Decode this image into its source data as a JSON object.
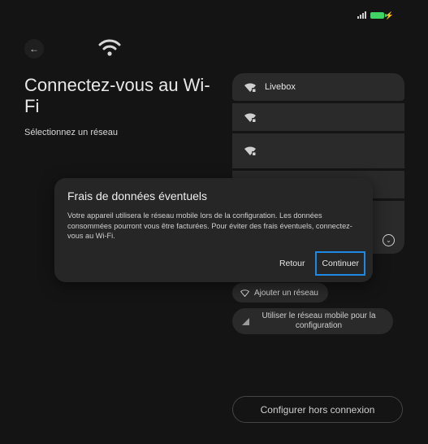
{
  "header": {
    "title": "Connectez-vous au Wi-Fi",
    "subtitle": "Sélectionnez un réseau"
  },
  "networks": [
    {
      "ssid": "Livebox"
    },
    {
      "ssid": ""
    },
    {
      "ssid": ""
    },
    {
      "ssid": ""
    },
    {
      "ssid": ""
    }
  ],
  "actions": {
    "add_network": "Ajouter un réseau",
    "use_mobile": "Utiliser le réseau mobile pour la configuration",
    "offline": "Configurer hors connexion"
  },
  "dialog": {
    "title": "Frais de données éventuels",
    "body": "Votre appareil utilisera le réseau mobile lors de la configuration. Les données consommées pourront vous être facturées. Pour éviter des frais éventuels, connectez-vous au Wi-Fi.",
    "back_label": "Retour",
    "continue_label": "Continuer"
  },
  "colors": {
    "background": "#141414",
    "surface": "#2a2a2a",
    "focus": "#1e88e5",
    "battery": "#3fd463"
  }
}
